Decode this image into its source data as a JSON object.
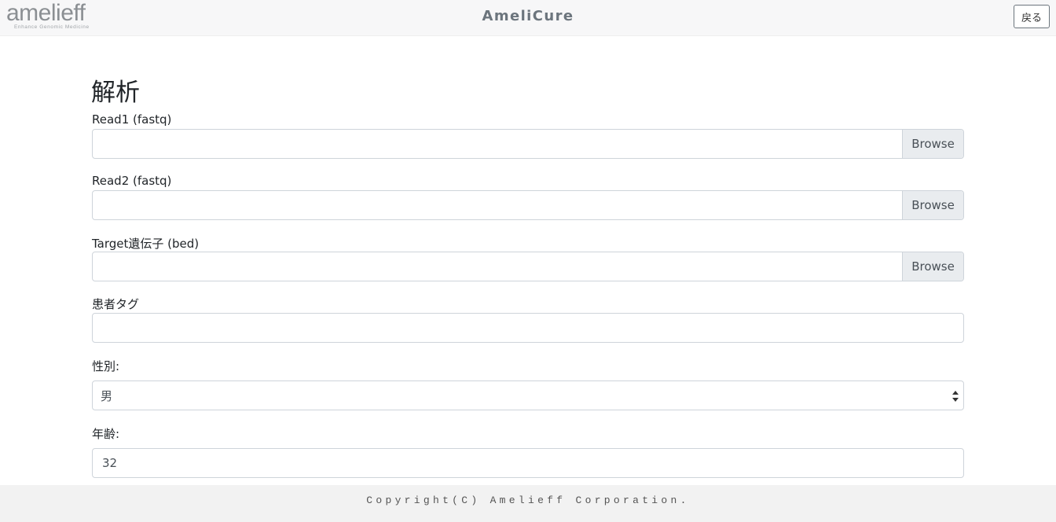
{
  "header": {
    "logo_text": "amelieff",
    "logo_tagline": "Enhance Genomic Medicine",
    "app_title": "AmeliCure",
    "back_label": "戻る"
  },
  "main": {
    "title": "解析",
    "read1": {
      "label": "Read1 (fastq)",
      "value": "",
      "browse_label": "Browse"
    },
    "read2": {
      "label": "Read2 (fastq)",
      "value": "",
      "browse_label": "Browse"
    },
    "target": {
      "label": "Target遺伝子 (bed)",
      "value": "",
      "browse_label": "Browse"
    },
    "patient_tag": {
      "label": "患者タグ",
      "value": ""
    },
    "sex": {
      "label": "性別:",
      "selected": "男"
    },
    "age": {
      "label": "年齢:",
      "value": "32"
    }
  },
  "footer": {
    "copyright": "Copyright(C) Amelieff Corporation."
  },
  "colors": {
    "navbar_bg": "#f7f7f8",
    "browse_bg": "#e9ecef",
    "border": "#ced4da",
    "footer_bg": "#f2f2f2"
  }
}
